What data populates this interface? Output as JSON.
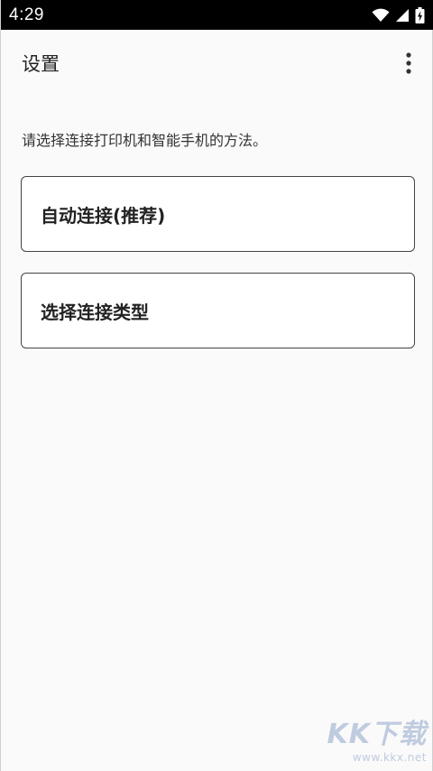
{
  "status_bar": {
    "time": "4:29",
    "icons": [
      "wifi-icon",
      "signal-icon",
      "battery-charging-icon"
    ]
  },
  "app_bar": {
    "title": "设置",
    "overflow_icon": "more-vert-icon"
  },
  "description": "请选择连接打印机和智能手机的方法。",
  "options": [
    {
      "label": "自动连接(推荐)"
    },
    {
      "label": "选择连接类型"
    }
  ],
  "watermark": {
    "text": "KK下载",
    "url": "www.kkx.net"
  },
  "colors": {
    "status_bar_bg": "#000000",
    "background": "#fafafa",
    "card_border": "#444444",
    "watermark": "#8fa6c9"
  }
}
